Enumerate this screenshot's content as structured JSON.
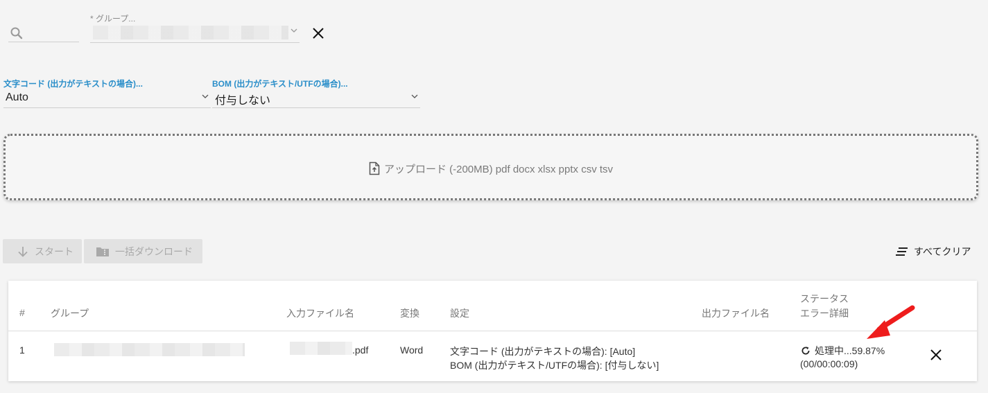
{
  "filters": {
    "group_label": "* グループ...",
    "encoding_label": "文字コード (出力がテキストの場合)...",
    "encoding_value": "Auto",
    "bom_label": "BOM (出力がテキスト/UTFの場合)...",
    "bom_value": "付与しない"
  },
  "upload": {
    "text": "アップロード (-200MB) pdf docx xlsx pptx csv tsv"
  },
  "toolbar": {
    "start_label": "スタート",
    "bulk_download_label": "一括ダウンロード",
    "clear_all_label": "すべてクリア"
  },
  "table": {
    "headers": {
      "index": "#",
      "group": "グループ",
      "input_file": "入力ファイル名",
      "convert": "変換",
      "settings": "設定",
      "output_file": "出力ファイル名",
      "status": "ステータス",
      "error": "エラー詳細"
    },
    "rows": [
      {
        "index": "1",
        "input_file_suffix": ".pdf",
        "convert": "Word",
        "setting_encoding": "文字コード (出力がテキストの場合): [Auto]",
        "setting_bom": "BOM (出力がテキスト/UTFの場合): [付与しない]",
        "status": "処理中...59.87%",
        "elapsed": "(00/00:00:09)"
      }
    ]
  },
  "colors": {
    "accent_label": "#2a8ec9",
    "annotation_arrow": "#ee1c1c"
  }
}
